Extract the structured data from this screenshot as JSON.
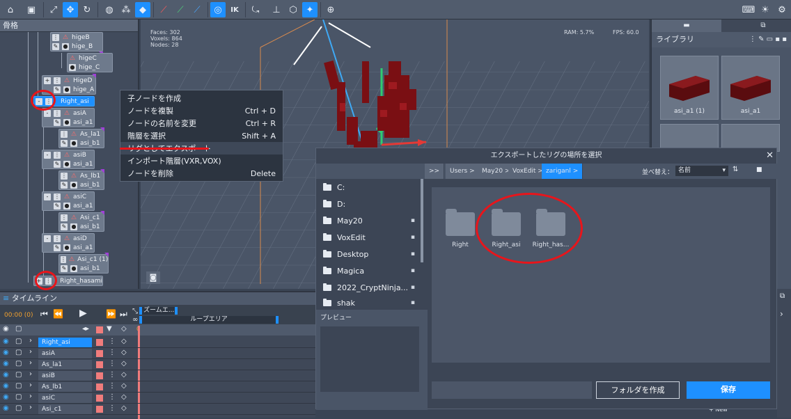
{
  "toolbar": {
    "icons": [
      "home-icon",
      "save-icon",
      "fit-icon",
      "move-icon",
      "rotate-icon",
      "globe-icon",
      "nodes-icon",
      "cube-icon",
      "link-icon",
      "chain-icon",
      "bolt-icon",
      "world-icon",
      "ik-label",
      "export-icon",
      "hierarchy-icon",
      "cube-outline-icon",
      "sparkle-icon",
      "target-icon",
      "keyboard-icon",
      "bulb-icon",
      "gear-icon"
    ],
    "ik_label": "IK"
  },
  "skeleton": {
    "title": "骨格",
    "nodes": [
      {
        "name": "higeB",
        "sub": "hige_B"
      },
      {
        "name": "higeC",
        "sub": "hige_C"
      },
      {
        "name": "HigeD",
        "sub": "hige_A"
      },
      {
        "name": "Right_asi",
        "sub": ""
      },
      {
        "name": "asiA",
        "sub": "asi_a1"
      },
      {
        "name": "As_la1",
        "sub": "asi_b1"
      },
      {
        "name": "asiB",
        "sub": "asi_a1"
      },
      {
        "name": "As_lb1",
        "sub": "asi_b1"
      },
      {
        "name": "asiC",
        "sub": "asi_a1"
      },
      {
        "name": "Asi_c1",
        "sub": "asi_b1"
      },
      {
        "name": "asiD",
        "sub": "asi_a1"
      },
      {
        "name": "Asi_c1 (1)",
        "sub": "asi_b1"
      },
      {
        "name": "Right_hasami",
        "sub": ""
      }
    ]
  },
  "viewport": {
    "faces": "Faces: 302",
    "voxels": "Voxels: 864",
    "nodes": "Nodes: 28",
    "ram": "RAM: 5.7%",
    "fps": "FPS: 60.0"
  },
  "library": {
    "title": "ライブラリ",
    "items": [
      {
        "label": "asi_a1 (1)"
      },
      {
        "label": "asi_a1"
      }
    ]
  },
  "context_menu": {
    "items": [
      {
        "label": "子ノードを作成",
        "shortcut": ""
      },
      {
        "label": "ノードを複製",
        "shortcut": "Ctrl + D"
      },
      {
        "label": "ノードの名前を変更",
        "shortcut": "Ctrl + R"
      },
      {
        "label": "階層を選択",
        "shortcut": "Shift + A"
      },
      {
        "label": "リグとしてエクスポート",
        "shortcut": ""
      },
      {
        "label": "インポート階層(VXR,VOX)",
        "shortcut": ""
      },
      {
        "label": "ノードを削除",
        "shortcut": "Delete"
      }
    ]
  },
  "timeline": {
    "title": "タイムライン",
    "time": "00:00 (0)",
    "zoom_label": "ズームエ...",
    "loop_label": "ループエリア",
    "frame": "0",
    "rows": [
      "Right_asi",
      "asiA",
      "As_la1",
      "asiB",
      "As_lb1",
      "asiC",
      "Asi_c1"
    ]
  },
  "dialog": {
    "title": "エクスポートしたリグの場所を選択",
    "close": "✕",
    "breadcrumb": [
      ">>",
      "Users >",
      "May20 >",
      "VoxEdit >",
      "zariganl >"
    ],
    "sort_label": "並べ替え：",
    "sort_value": "名前",
    "sidebar": [
      "C:",
      "D:",
      "May20",
      "VoxEdit",
      "Desktop",
      "Magica",
      "2022_CryptNinja...",
      "shak"
    ],
    "preview_label": "プレビュー",
    "folders": [
      "Right",
      "Right_asi",
      "Right_has..."
    ],
    "create_folder": "フォルダを作成",
    "save": "保存",
    "filename": ""
  },
  "footer": {
    "new_label": "New"
  }
}
